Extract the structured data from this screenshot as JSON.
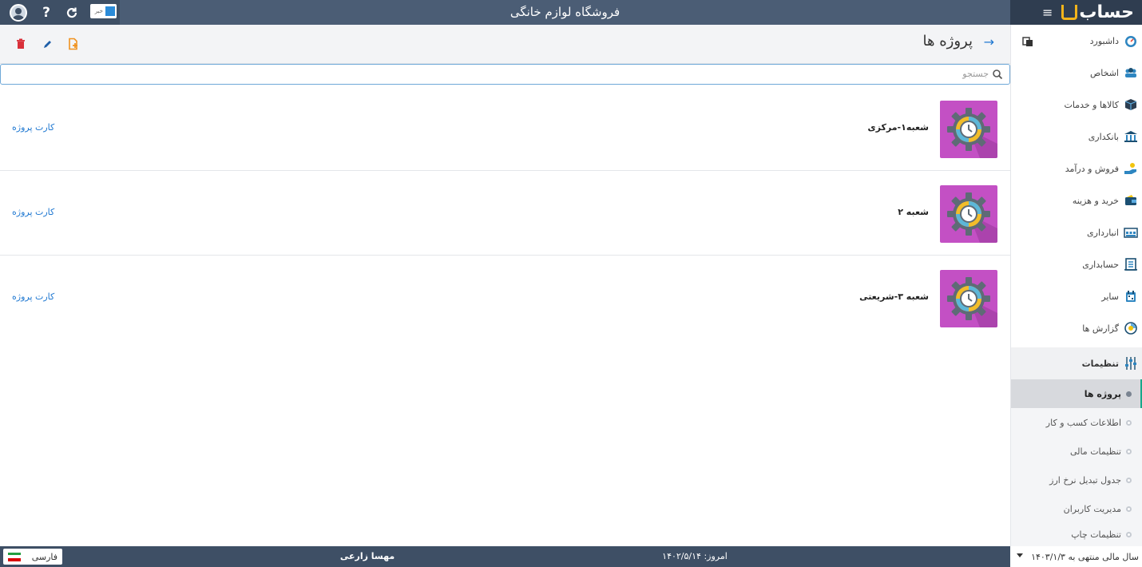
{
  "app": {
    "title": "فروشگاه لوازم خانگی",
    "logo_text": "حساب",
    "brand_color": "#3e4f65",
    "accent_color": "#1f78d1"
  },
  "topbar": {
    "news_label": "خبر"
  },
  "page": {
    "title": "پروژه ها"
  },
  "search": {
    "placeholder": "جستجو",
    "value": ""
  },
  "projects": [
    {
      "name": "شعبه۱-مرکزی",
      "link": "کارت پروژه",
      "thumb_color": "#c350c4"
    },
    {
      "name": "شعبه ۲",
      "link": "کارت پروژه",
      "thumb_color": "#c350c4"
    },
    {
      "name": "شعبه ۳-شریعتی",
      "link": "کارت پروژه",
      "thumb_color": "#c350c4"
    }
  ],
  "sidebar": {
    "items": [
      {
        "label": "داشبورد",
        "icon": "dashboard-icon"
      },
      {
        "label": "اشخاص",
        "icon": "people-icon"
      },
      {
        "label": "کالاها و خدمات",
        "icon": "box-icon"
      },
      {
        "label": "بانکداری",
        "icon": "bank-icon"
      },
      {
        "label": "فروش و درآمد",
        "icon": "sales-icon"
      },
      {
        "label": "خرید و هزینه",
        "icon": "wallet-icon"
      },
      {
        "label": "انبارداری",
        "icon": "warehouse-icon"
      },
      {
        "label": "حسابداری",
        "icon": "ledger-icon"
      },
      {
        "label": "سایر",
        "icon": "calendar-icon"
      },
      {
        "label": "گزارش ها",
        "icon": "report-icon"
      }
    ],
    "settings": {
      "label": "تنظیمات",
      "icon": "sliders-icon"
    },
    "sub_items": [
      {
        "label": "پروژه ها",
        "active": true
      },
      {
        "label": "اطلاعات کسب و کار",
        "active": false
      },
      {
        "label": "تنظیمات مالی",
        "active": false
      },
      {
        "label": "جدول تبدیل نرخ ارز",
        "active": false
      },
      {
        "label": "مدیریت کاربران",
        "active": false
      },
      {
        "label": "تنظیمات چاپ",
        "active": false
      }
    ]
  },
  "footer": {
    "language": "فارسی",
    "user": "مهسا زارعی",
    "today": "امروز: ۱۴۰۲/۵/۱۴",
    "fiscal_year": "سال مالی منتهی به ۱۴۰۳/۱/۳"
  }
}
